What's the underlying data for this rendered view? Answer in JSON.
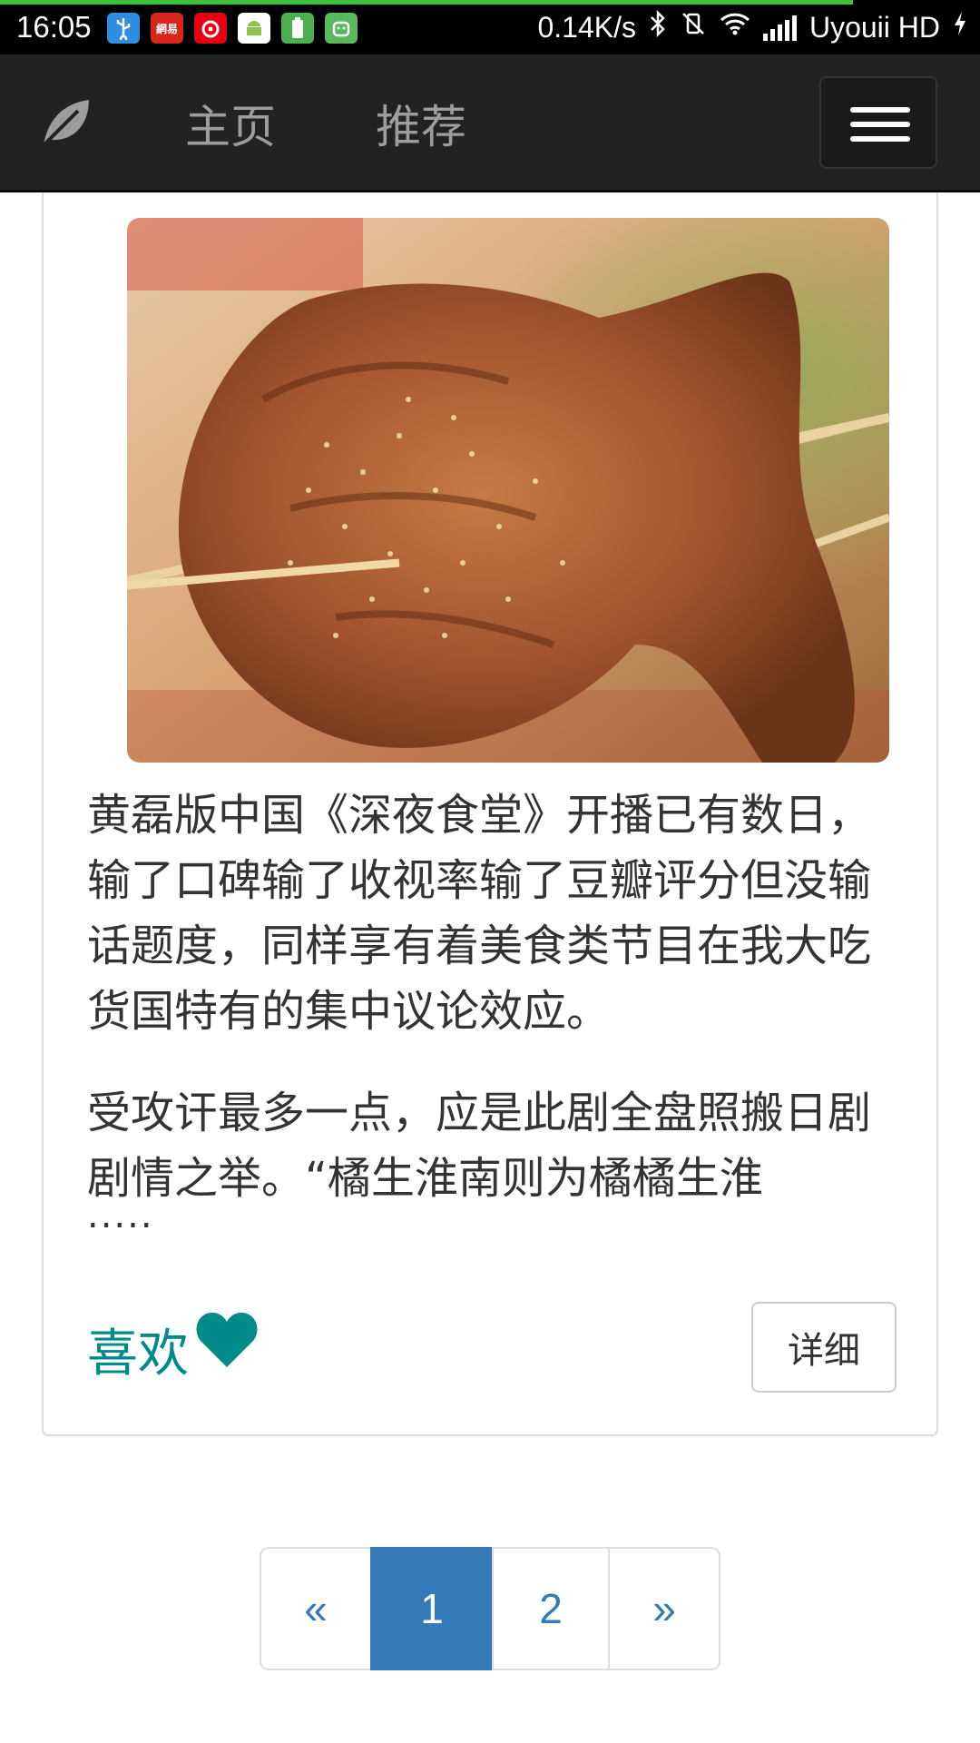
{
  "status_bar": {
    "time": "16:05",
    "net_speed": "0.14K/s",
    "carrier": "Uyouii HD",
    "app_icons": [
      "usb-icon",
      "netease-news-icon",
      "netease-music-icon",
      "android-icon",
      "battery-app-icon",
      "android-green-icon"
    ],
    "netease_label": "網易"
  },
  "navbar": {
    "brand_icon": "leaf-icon",
    "home": "主页",
    "recommend": "推荐",
    "toggle_icon": "hamburger-menu-icon"
  },
  "article": {
    "paragraph1": "黄磊版中国《深夜食堂》开播已有数日，输了口碑输了收视率输了豆瓣评分但没输话题度，同样享有着美食类节目在我大吃货国特有的集中议论效应。",
    "paragraph2": "受攻讦最多一点，应是此剧全盘照搬日剧剧情之举。“橘生淮南则为橘橘生淮",
    "ellipsis": ".....",
    "like_label": "喜欢",
    "detail_button": "详细"
  },
  "pagination": {
    "prev": "«",
    "pages": [
      "1",
      "2"
    ],
    "next": "»",
    "active": "1"
  },
  "colors": {
    "navbar_bg": "#222222",
    "nav_link": "#9d9d9d",
    "like": "#008b8b",
    "page_active": "#337ab7",
    "progress": "#39c339"
  }
}
